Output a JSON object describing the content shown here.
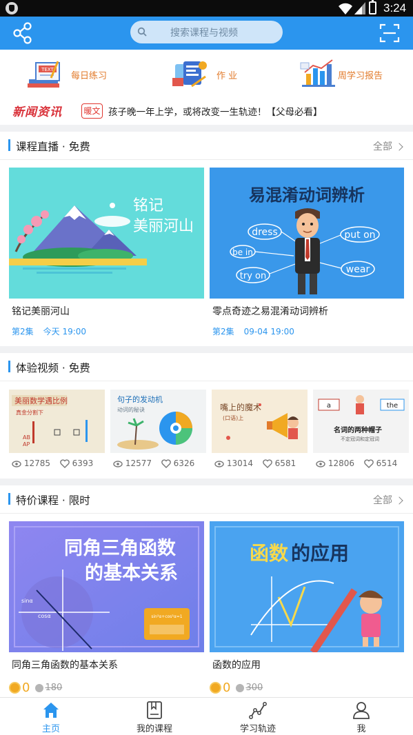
{
  "status_bar": {
    "time": "3:24"
  },
  "header": {
    "search_placeholder": "搜索课程与视频"
  },
  "shortcuts": [
    {
      "label": "每日练习",
      "icon": "practice-icon"
    },
    {
      "label": "作 业",
      "icon": "homework-icon"
    },
    {
      "label": "周学习报告",
      "icon": "report-icon"
    }
  ],
  "news": {
    "logo": "新闻资讯",
    "tag": "暖文",
    "text": "孩子晚一年上学，或将改变一生轨迹！【父母必看】"
  },
  "live": {
    "title": "课程直播 · 免费",
    "more": "全部",
    "courses": [
      {
        "thumb_text_1": "铭记",
        "thumb_text_2": "美丽河山",
        "title": "铭记美丽河山",
        "episode": "第2集",
        "time": "今天 19:00"
      },
      {
        "thumb_title": "易混淆动词辨析",
        "words": [
          "dress",
          "put on",
          "be in",
          "wear",
          "try on"
        ],
        "title": "零点奇迹之易混淆动词辨析",
        "episode": "第2集",
        "time": "09-04 19:00"
      }
    ]
  },
  "trial": {
    "title": "体验视频 · 免费",
    "videos": [
      {
        "thumb_text": "美丽数学遇比例",
        "thumb_sub": "真金分割下",
        "views": "12785",
        "likes": "6393"
      },
      {
        "thumb_text": "句子的发动机",
        "thumb_sub": "动词的秘诀",
        "views": "12577",
        "likes": "6326"
      },
      {
        "thumb_text": "嘴上的魔术",
        "thumb_sub": "(口语)上",
        "views": "13014",
        "likes": "6581"
      },
      {
        "thumb_text": "名词的两种帽子",
        "thumb_sub": "不定冠词和定冠词",
        "thumb_words": [
          "a",
          "the"
        ],
        "views": "12806",
        "likes": "6514"
      }
    ]
  },
  "special": {
    "title": "特价课程 · 限时",
    "more": "全部",
    "courses": [
      {
        "thumb_line_1": "同角三角函数",
        "thumb_line_2": "的基本关系",
        "title": "同角三角函数的基本关系",
        "price": "0",
        "old_price": "180"
      },
      {
        "thumb_title_a": "函数",
        "thumb_title_b": "的应用",
        "title": "函数的应用",
        "price": "0",
        "old_price": "300"
      }
    ]
  },
  "bottom_nav": [
    {
      "label": "主页",
      "icon": "home-icon",
      "active": true
    },
    {
      "label": "我的课程",
      "icon": "book-icon",
      "active": false
    },
    {
      "label": "学习轨迹",
      "icon": "trend-icon",
      "active": false
    },
    {
      "label": "我",
      "icon": "person-icon",
      "active": false
    }
  ],
  "colors": {
    "primary": "#2b95ee",
    "accent": "#e27a2a",
    "price": "#f1a922",
    "news": "#d9323a"
  }
}
